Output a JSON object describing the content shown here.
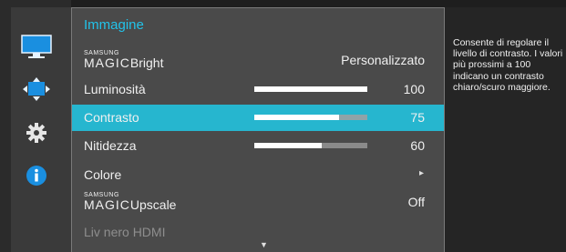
{
  "menu": {
    "title": "Immagine",
    "items": [
      {
        "brand_small": "SAMSUNG",
        "brand_big": "MAGIC",
        "label": "Bright",
        "value": "Personalizzato"
      },
      {
        "label": "Luminosità",
        "value": "100",
        "level": 100
      },
      {
        "label": "Contrasto",
        "value": "75",
        "level": 75,
        "selected": true
      },
      {
        "label": "Nitidezza",
        "value": "60",
        "level": 60
      },
      {
        "label": "Colore",
        "arrow": "▸"
      },
      {
        "brand_small": "SAMSUNG",
        "brand_big": "MAGIC",
        "label": "Upscale",
        "value": "Off"
      },
      {
        "label": "Liv nero HDMI",
        "disabled": true
      }
    ],
    "scroll_indicator": "▼"
  },
  "help": {
    "text": "Consente di regolare il livello di contrasto. I valori più prossimi a 100 indicano un contrasto chiaro/scuro maggiore."
  },
  "sidebar": {
    "icons": [
      "monitor-icon",
      "resize-icon",
      "gear-icon",
      "info-icon"
    ],
    "accent_color": "#1a8fe0"
  },
  "colors": {
    "title": "#22c3ea",
    "selected_row": "#26b6cf"
  }
}
